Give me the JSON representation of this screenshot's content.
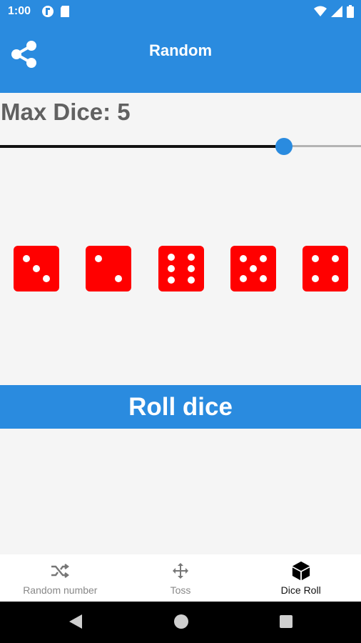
{
  "status_bar": {
    "time": "1:00",
    "left_icons": [
      "notification-icon",
      "sd-card-icon"
    ],
    "right_icons": [
      "wifi-icon",
      "signal-icon",
      "battery-icon"
    ]
  },
  "app_bar": {
    "title": "Random",
    "share_icon": "share-icon"
  },
  "dice_settings": {
    "label": "Max Dice: 5",
    "slider_fraction": 0.787
  },
  "dice": {
    "values": [
      3,
      2,
      6,
      5,
      4
    ],
    "color": "#ff0000"
  },
  "roll_button": {
    "label": "Roll dice"
  },
  "bottom_nav": {
    "items": [
      {
        "label": "Random number",
        "icon": "shuffle-icon",
        "active": false
      },
      {
        "label": "Toss",
        "icon": "move-icon",
        "active": false
      },
      {
        "label": "Dice Roll",
        "icon": "cube-icon",
        "active": true
      }
    ]
  },
  "system_nav": {
    "buttons": [
      "back-icon",
      "home-icon",
      "recents-icon"
    ]
  },
  "colors": {
    "primary": "#2a8bdf",
    "background": "#f5f5f5",
    "dice": "#ff0000",
    "text_gray": "#616161"
  }
}
